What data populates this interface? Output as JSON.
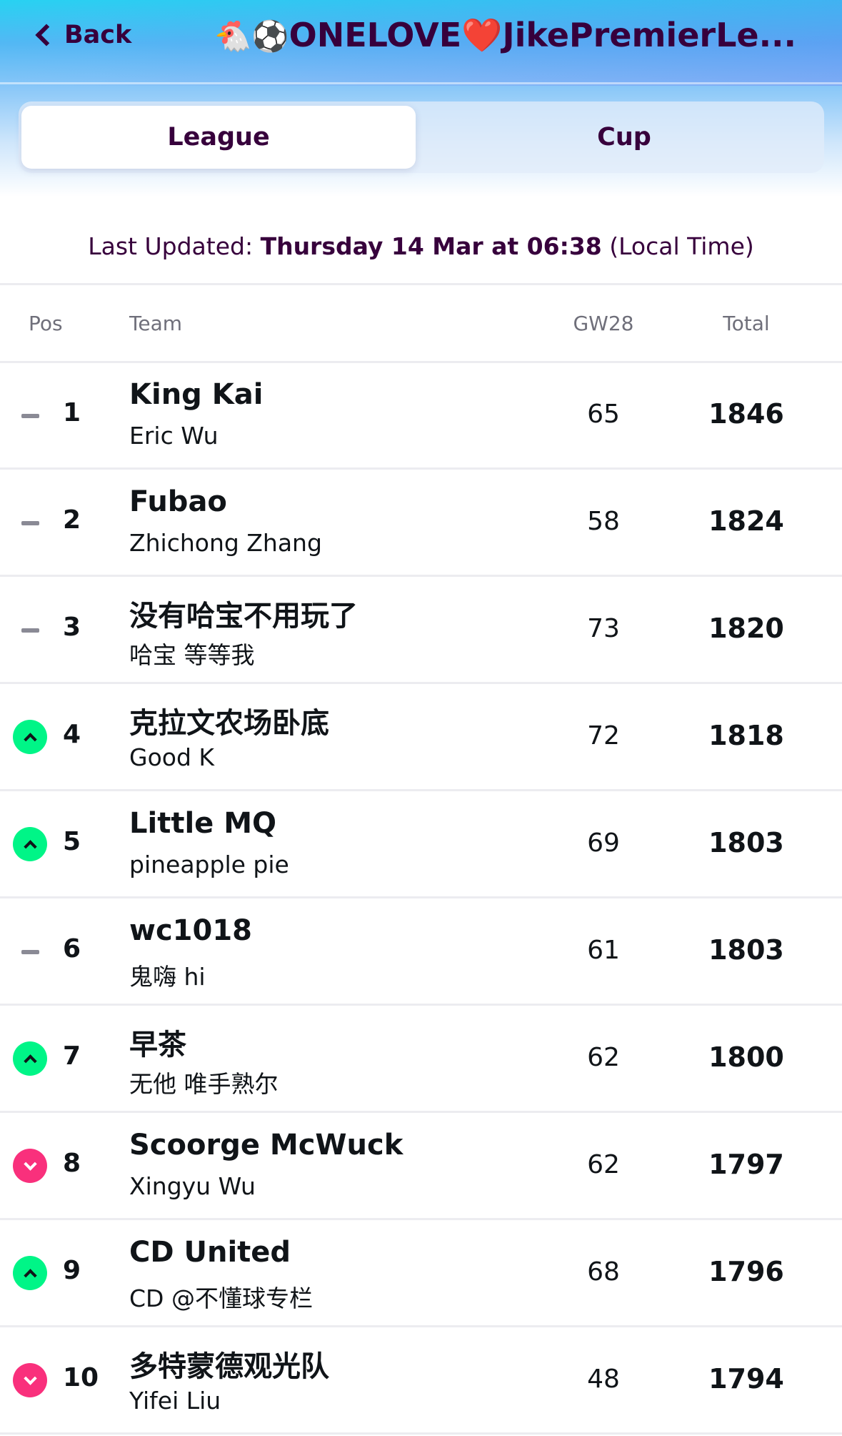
{
  "header": {
    "back_label": "Back",
    "title_emojis": "🐔⚽",
    "title_text": "ONELOVE❤️JikePremierLe..."
  },
  "tabs": [
    {
      "label": "League",
      "selected": true
    },
    {
      "label": "Cup",
      "selected": false
    }
  ],
  "last_updated": {
    "prefix": "Last Updated:",
    "datetime": "Thursday 14 Mar at 06:38",
    "suffix": "(Local Time)"
  },
  "table": {
    "columns": {
      "pos": "Pos",
      "team": "Team",
      "gw": "GW28",
      "total": "Total"
    },
    "rows": [
      {
        "movement": "same",
        "pos": "1",
        "team": "King Kai",
        "manager": "Eric Wu",
        "gw": "65",
        "total": "1846"
      },
      {
        "movement": "same",
        "pos": "2",
        "team": "Fubao",
        "manager": "Zhichong Zhang",
        "gw": "58",
        "total": "1824"
      },
      {
        "movement": "same",
        "pos": "3",
        "team": "没有哈宝不用玩了",
        "manager": "哈宝 等等我",
        "gw": "73",
        "total": "1820"
      },
      {
        "movement": "up",
        "pos": "4",
        "team": "克拉文农场卧底",
        "manager": "Good K",
        "gw": "72",
        "total": "1818"
      },
      {
        "movement": "up",
        "pos": "5",
        "team": "Little MQ",
        "manager": "pineapple pie",
        "gw": "69",
        "total": "1803"
      },
      {
        "movement": "same",
        "pos": "6",
        "team": "wc1018",
        "manager": "鬼嗨 hi",
        "gw": "61",
        "total": "1803"
      },
      {
        "movement": "up",
        "pos": "7",
        "team": "早茶",
        "manager": "无他 唯手熟尔",
        "gw": "62",
        "total": "1800"
      },
      {
        "movement": "down",
        "pos": "8",
        "team": "Scoorge McWuck",
        "manager": "Xingyu Wu",
        "gw": "62",
        "total": "1797"
      },
      {
        "movement": "up",
        "pos": "9",
        "team": "CD United",
        "manager": "CD @不懂球专栏",
        "gw": "68",
        "total": "1796"
      },
      {
        "movement": "down",
        "pos": "10",
        "team": "多特蒙德观光队",
        "manager": "Yifei Liu",
        "gw": "48",
        "total": "1794"
      }
    ]
  },
  "colors": {
    "brand_purple": "#37003c",
    "up_green": "#00f587",
    "down_pink": "#f9307c",
    "header_cyan": "#28d2f2"
  }
}
